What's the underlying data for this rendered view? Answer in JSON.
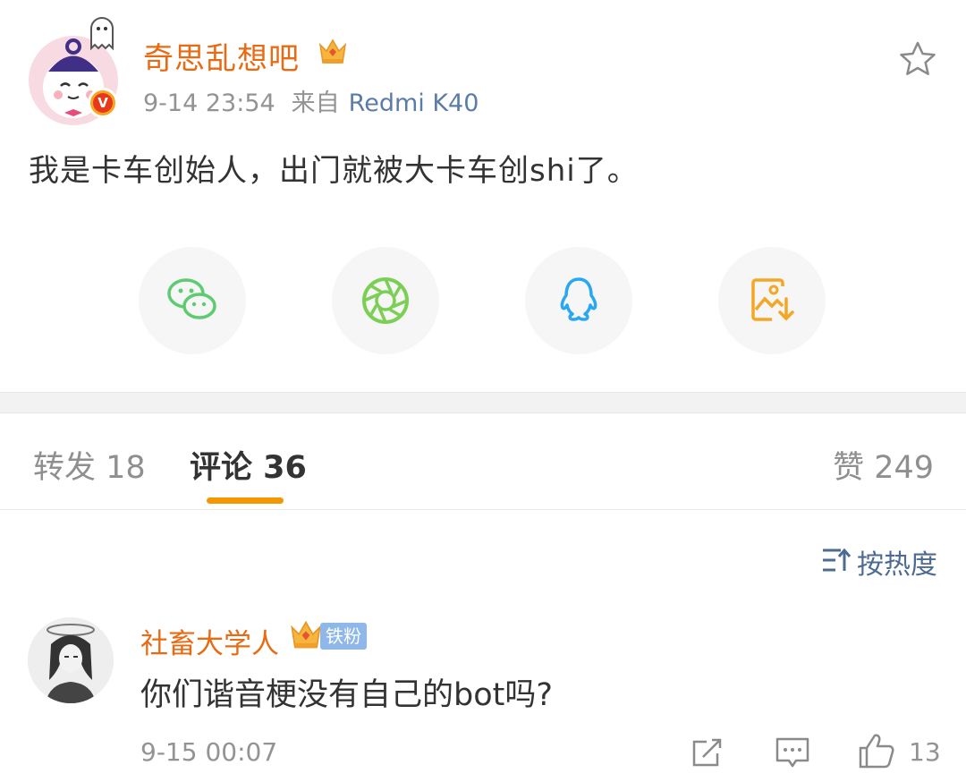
{
  "post": {
    "author": "奇思乱想吧",
    "time": "9-14 23:54",
    "source_prefix": "来自",
    "source": "Redmi K40",
    "content": "我是卡车创始人，出门就被大卡车创shi了。",
    "verified_badge": "V"
  },
  "share_buttons": [
    {
      "icon": "wechat-icon",
      "color": "#5ecb71"
    },
    {
      "icon": "moments-icon",
      "color": "#7ccf55"
    },
    {
      "icon": "qq-icon",
      "color": "#2aa7f1"
    },
    {
      "icon": "save-image-icon",
      "color": "#f5a623"
    }
  ],
  "tabs": {
    "repost": "转发 18",
    "comment": "评论 36",
    "like": "赞 249"
  },
  "sort": {
    "label": "按热度"
  },
  "comment": {
    "author": "社畜大学人",
    "fan_badge": "铁粉",
    "text": "你们谐音梗没有自己的bot吗?",
    "time": "9-15 00:07",
    "like_count": "13"
  },
  "colors": {
    "accent": "#f39800",
    "author": "#e86b13",
    "link": "#4c6b93",
    "muted": "#939393"
  }
}
